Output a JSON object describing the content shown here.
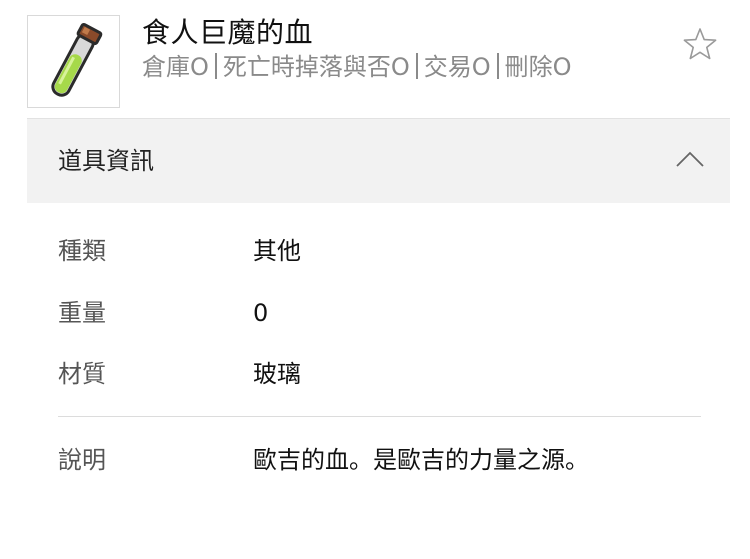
{
  "item": {
    "name": "食人巨魔的血",
    "icon": "potion-vial-icon",
    "tags": [
      "倉庫O",
      "死亡時掉落與否O",
      "交易O",
      "刪除O"
    ],
    "favorite_icon": "star-outline-icon"
  },
  "section": {
    "title": "道具資訊",
    "toggle_icon": "chevron-up-icon"
  },
  "info": {
    "type": {
      "label": "種類",
      "value": "其他"
    },
    "weight": {
      "label": "重量",
      "value": "0"
    },
    "material": {
      "label": "材質",
      "value": "玻璃"
    },
    "description": {
      "label": "說明",
      "value": "歐吉的血。是歐吉的力量之源。"
    }
  },
  "colors": {
    "section_bg": "#f2f2f2",
    "tag_text": "#8a8a8a",
    "label_text": "#555555",
    "liquid": "#a6d94a",
    "cork": "#8a4a2a"
  }
}
